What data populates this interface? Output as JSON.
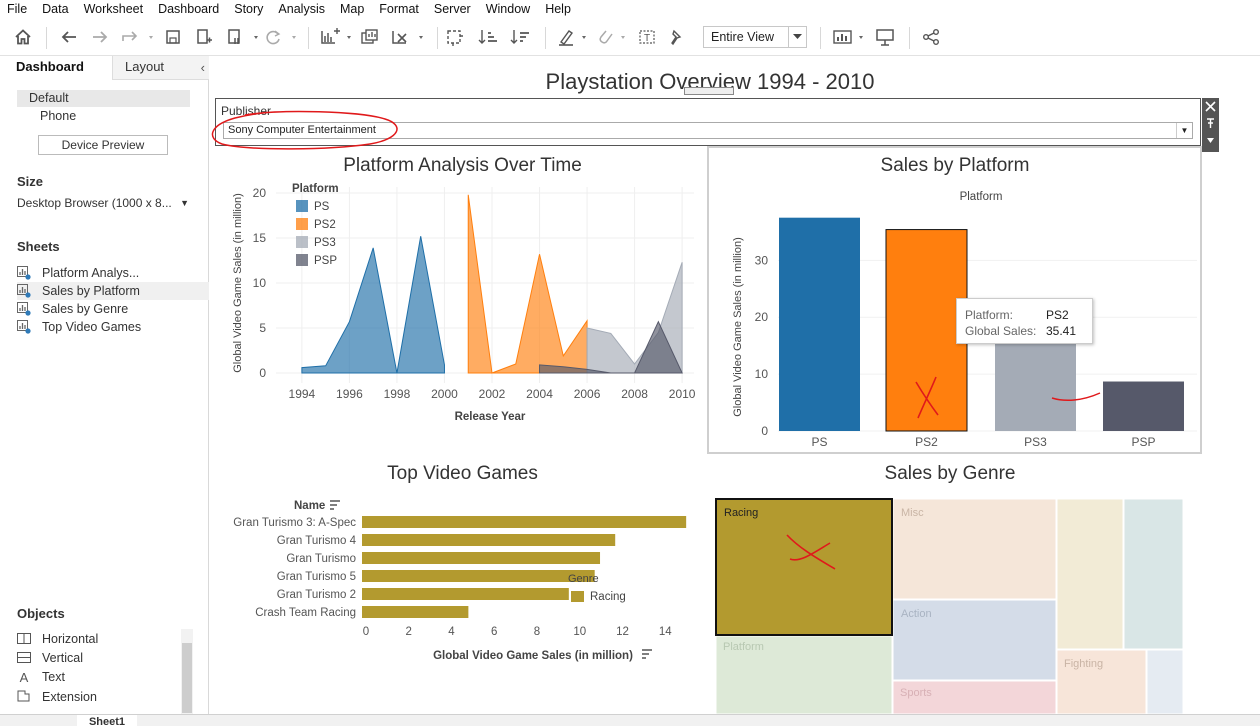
{
  "menu": [
    "File",
    "Data",
    "Worksheet",
    "Dashboard",
    "Story",
    "Analysis",
    "Map",
    "Format",
    "Server",
    "Window",
    "Help"
  ],
  "toolbar": {
    "view_select": "Entire View",
    "icons": [
      "home-icon",
      "undo-icon",
      "redo-icon",
      "replay-icon",
      "save-icon",
      "new-data-source-icon",
      "pause-auto-updates-icon",
      "refresh-icon",
      "new-worksheet-icon",
      "duplicate-sheet-icon",
      "clear-sheet-icon",
      "swap-rows-columns-icon",
      "sort-ascending-icon",
      "sort-descending-icon",
      "highlight-icon",
      "group-members-icon",
      "show-mark-labels-icon",
      "fix-axes-icon",
      "show-me-icon",
      "presentation-mode-icon",
      "share-icon"
    ]
  },
  "left_panel": {
    "tabs": [
      "Dashboard",
      "Layout"
    ],
    "device": {
      "default": "Default",
      "phone": "Phone",
      "preview_button": "Device Preview"
    },
    "size": {
      "heading": "Size",
      "value": "Desktop Browser (1000 x 8..."
    },
    "sheets": {
      "heading": "Sheets",
      "items": [
        "Platform Analys...",
        "Sales by Platform",
        "Sales by Genre",
        "Top Video Games"
      ]
    },
    "objects": {
      "heading": "Objects",
      "items": [
        {
          "label": "Horizontal",
          "icon": "horizontal-container-icon"
        },
        {
          "label": "Vertical",
          "icon": "vertical-container-icon"
        },
        {
          "label": "Text",
          "icon": "text-object-icon"
        },
        {
          "label": "Extension",
          "icon": "extension-icon"
        }
      ]
    }
  },
  "dashboard": {
    "title": "Playstation Overview 1994 - 2010",
    "filter": {
      "label": "Publisher",
      "value": "Sony Computer Entertainment"
    }
  },
  "colors": {
    "PS": "#1f6fa8",
    "PS2": "#ff7f0e",
    "PS3": "#a4abb6",
    "PSP": "#56596a",
    "racing": "#b39a2f",
    "annotation": "#e0191b"
  },
  "chart_data": [
    {
      "type": "area",
      "title": "Platform Analysis Over Time",
      "xlabel": "Release Year",
      "ylabel": "Global Video Game Sales (in million)",
      "legend_title": "Platform",
      "legend_placement": "top-left",
      "x_ticks": [
        1994,
        1996,
        1998,
        2000,
        2002,
        2004,
        2006,
        2008,
        2010
      ],
      "y_ticks": [
        0,
        5,
        10,
        15,
        20
      ],
      "xlim": [
        1993.5,
        2010.5
      ],
      "ylim": [
        0,
        20
      ],
      "series": [
        {
          "name": "PS",
          "x": [
            1994,
            1995,
            1996,
            1997,
            1998,
            1999,
            2000
          ],
          "values": [
            0.6,
            0.8,
            5.7,
            13.9,
            0,
            15.2,
            0.9
          ]
        },
        {
          "name": "PS2",
          "x": [
            2001,
            2002,
            2003,
            2004,
            2005,
            2006
          ],
          "values": [
            19.8,
            0,
            1,
            13.2,
            1.9,
            5.8
          ]
        },
        {
          "name": "PS3",
          "x": [
            2006,
            2007,
            2008,
            2009,
            2010
          ],
          "values": [
            5,
            4.4,
            1,
            4.5,
            12.3
          ]
        },
        {
          "name": "PSP",
          "x": [
            2004,
            2005,
            2006,
            2007,
            2008,
            2009,
            2010
          ],
          "values": [
            0.9,
            0.7,
            0.4,
            0,
            0,
            5.7,
            0
          ]
        }
      ]
    },
    {
      "type": "bar",
      "title": "Sales by Platform",
      "legend_title": "Platform",
      "ylabel": "Global Video Game Sales (in million)",
      "categories": [
        "PS",
        "PS2",
        "PS3",
        "PSP"
      ],
      "values": [
        37.5,
        35.41,
        15.6,
        8.7
      ],
      "y_ticks": [
        0,
        10,
        20,
        30
      ],
      "ylim": [
        0,
        38.5
      ],
      "tooltip": {
        "platform_label": "Platform:",
        "platform_value": "PS2",
        "sales_label": "Global Sales:",
        "sales_value": "35.41"
      }
    },
    {
      "type": "bar",
      "orientation": "horizontal",
      "title": "Top Video Games",
      "row_header": "Name",
      "xlabel": "Global Video Game Sales (in million)",
      "categories": [
        "Gran Turismo 3: A-Spec",
        "Gran Turismo 4",
        "Gran Turismo",
        "Gran Turismo 5",
        "Gran Turismo 2",
        "Crash Team Racing"
      ],
      "values": [
        14.98,
        11.66,
        10.95,
        10.7,
        9.49,
        4.79
      ],
      "x_ticks": [
        0,
        2,
        4,
        6,
        8,
        10,
        12,
        14
      ],
      "xlim": [
        0,
        15.3
      ],
      "legend_title": "Genre",
      "legend": [
        "Racing"
      ]
    },
    {
      "type": "treemap",
      "title": "Sales by Genre",
      "categories": [
        "Racing",
        "Misc",
        "Action",
        "Platform",
        "Sports",
        "Fighting"
      ],
      "selected": "Racing"
    }
  ]
}
